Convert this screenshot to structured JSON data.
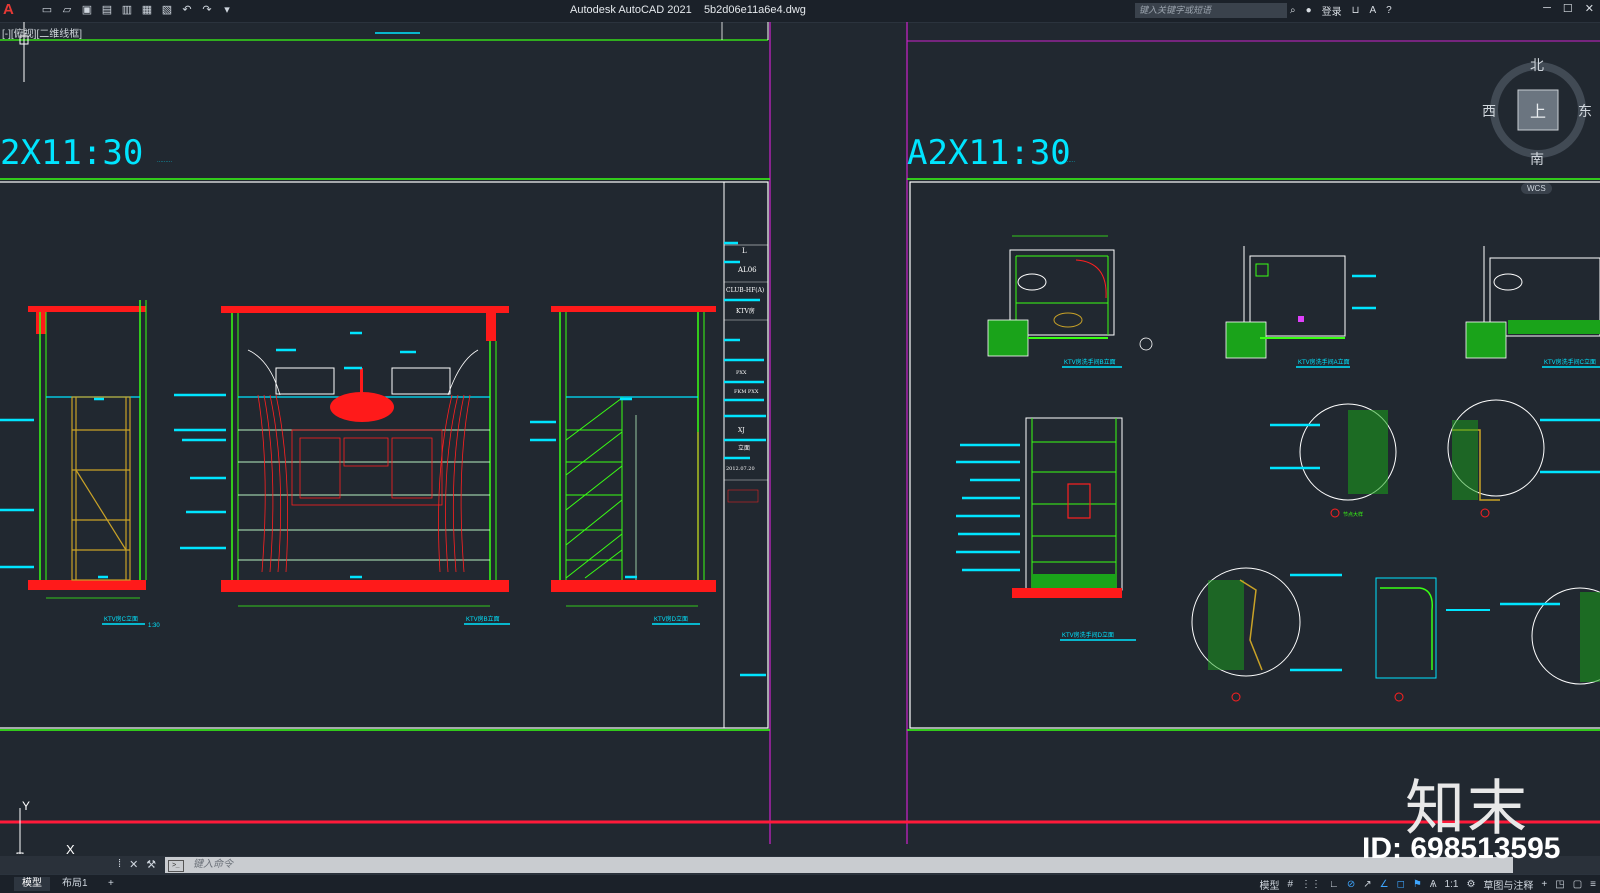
{
  "titlebar": {
    "app_logo": "A",
    "title": "Autodesk AutoCAD 2021",
    "filename": "5b2d06e11a6e4.dwg",
    "search_placeholder": "键入关键字或短语",
    "login": "登录"
  },
  "viewport": {
    "label": "[-][俯视][二维线框]"
  },
  "drawing": {
    "scale_left": "2X11:30",
    "scale_right": "A2X11:30",
    "title_block": {
      "sheet_no": "L",
      "drawing_code": "AL06",
      "project": "CLUB-HF(A)",
      "room": "KTV房",
      "designer": "PXX",
      "checker": "FKM PXX",
      "drawer": "XJ",
      "type": "立面",
      "date": "2012.07.20"
    },
    "captions_left": [
      "KTV房C立面",
      "KTV房B立面",
      "KTV房D立面"
    ],
    "captions_right": [
      "KTV房洗手间B立面",
      "KTV房洗手间A立面",
      "KTV房洗手间C立面",
      "KTV房洗手间D立面"
    ],
    "scale_caption": "1:30",
    "detail_label": "节点大样"
  },
  "viewcube": {
    "north": "北",
    "south": "南",
    "east": "东",
    "west": "西",
    "face": "上",
    "wcs": "WCS"
  },
  "ucs": {
    "x": "X",
    "y": "Y"
  },
  "command": {
    "placeholder": "键入命令"
  },
  "status": {
    "tabs": [
      "模型",
      "布局1"
    ],
    "model": "模型",
    "scale": "1:1",
    "workspace": "草图与注释"
  },
  "watermark": {
    "logo": "知末",
    "id": "ID: 698513595"
  }
}
